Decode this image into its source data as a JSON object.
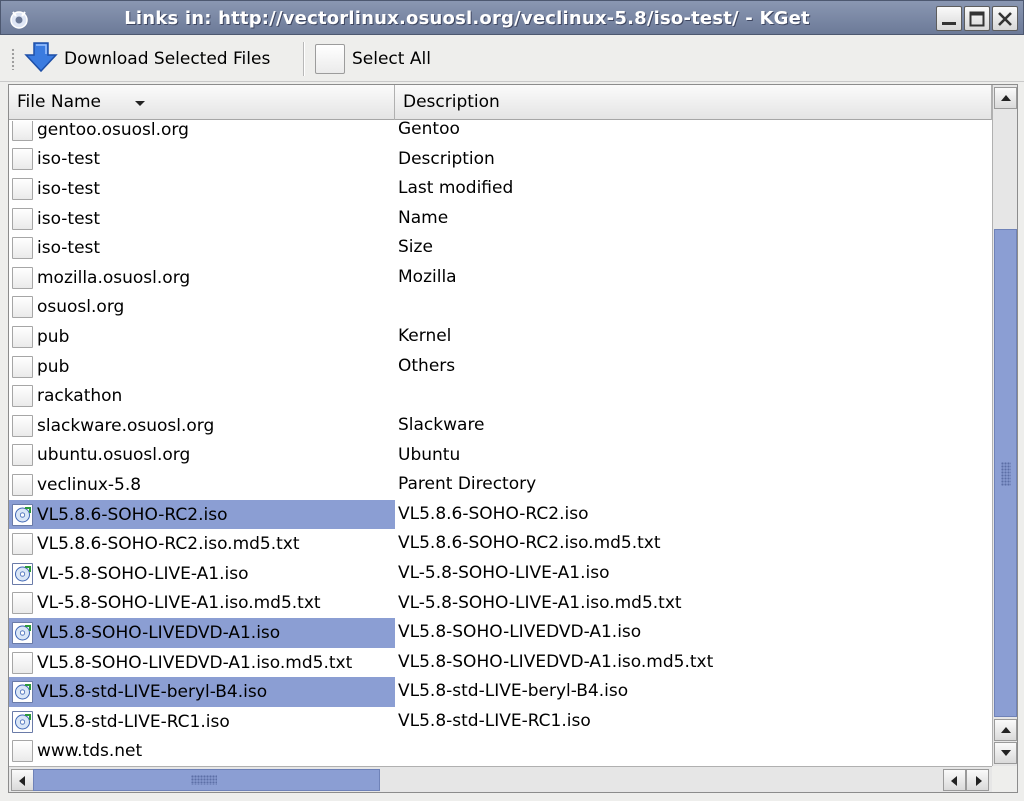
{
  "window": {
    "title": "Links in: http://vectorlinux.osuosl.org/veclinux-5.8/iso-test/ - KGet"
  },
  "toolbar": {
    "download_label": "Download Selected Files",
    "select_all_label": "Select All"
  },
  "columns": {
    "file_name": "File Name",
    "description": "Description"
  },
  "rows": [
    {
      "name": "gentoo.osuosl.org",
      "desc": "Gentoo",
      "selected": false,
      "iso": false
    },
    {
      "name": "iso-test",
      "desc": "Description",
      "selected": false,
      "iso": false
    },
    {
      "name": "iso-test",
      "desc": "Last modified",
      "selected": false,
      "iso": false
    },
    {
      "name": "iso-test",
      "desc": "Name",
      "selected": false,
      "iso": false
    },
    {
      "name": "iso-test",
      "desc": "Size",
      "selected": false,
      "iso": false
    },
    {
      "name": "mozilla.osuosl.org",
      "desc": "Mozilla",
      "selected": false,
      "iso": false
    },
    {
      "name": "osuosl.org",
      "desc": "",
      "selected": false,
      "iso": false
    },
    {
      "name": "pub",
      "desc": "Kernel",
      "selected": false,
      "iso": false
    },
    {
      "name": "pub",
      "desc": "Others",
      "selected": false,
      "iso": false
    },
    {
      "name": "rackathon",
      "desc": "",
      "selected": false,
      "iso": false
    },
    {
      "name": "slackware.osuosl.org",
      "desc": "Slackware",
      "selected": false,
      "iso": false
    },
    {
      "name": "ubuntu.osuosl.org",
      "desc": "Ubuntu",
      "selected": false,
      "iso": false
    },
    {
      "name": "veclinux-5.8",
      "desc": "Parent Directory",
      "selected": false,
      "iso": false
    },
    {
      "name": "VL5.8.6-SOHO-RC2.iso",
      "desc": "VL5.8.6-SOHO-RC2.iso",
      "selected": true,
      "iso": true
    },
    {
      "name": "VL5.8.6-SOHO-RC2.iso.md5.txt",
      "desc": "VL5.8.6-SOHO-RC2.iso.md5.txt",
      "selected": false,
      "iso": false
    },
    {
      "name": "VL-5.8-SOHO-LIVE-A1.iso",
      "desc": "VL-5.8-SOHO-LIVE-A1.iso",
      "selected": false,
      "iso": true
    },
    {
      "name": "VL-5.8-SOHO-LIVE-A1.iso.md5.txt",
      "desc": "VL-5.8-SOHO-LIVE-A1.iso.md5.txt",
      "selected": false,
      "iso": false
    },
    {
      "name": "VL5.8-SOHO-LIVEDVD-A1.iso",
      "desc": "VL5.8-SOHO-LIVEDVD-A1.iso",
      "selected": true,
      "iso": true
    },
    {
      "name": "VL5.8-SOHO-LIVEDVD-A1.iso.md5.txt",
      "desc": "VL5.8-SOHO-LIVEDVD-A1.iso.md5.txt",
      "selected": false,
      "iso": false
    },
    {
      "name": "VL5.8-std-LIVE-beryl-B4.iso",
      "desc": "VL5.8-std-LIVE-beryl-B4.iso",
      "selected": true,
      "iso": true
    },
    {
      "name": "VL5.8-std-LIVE-RC1.iso",
      "desc": "VL5.8-std-LIVE-RC1.iso",
      "selected": false,
      "iso": true
    },
    {
      "name": "www.tds.net",
      "desc": "",
      "selected": false,
      "iso": false
    }
  ]
}
